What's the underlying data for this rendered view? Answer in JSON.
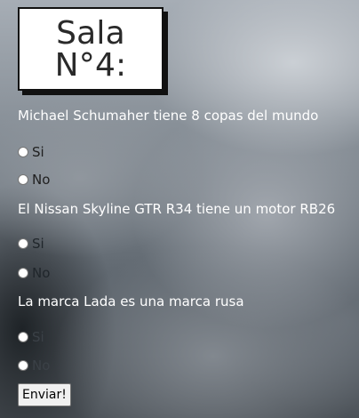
{
  "title": "Sala\nN°4:",
  "questions": [
    {
      "text": "Michael Schumaher tiene 8 copas del mundo",
      "options": [
        "Si",
        "No"
      ]
    },
    {
      "text": "El Nissan Skyline GTR R34 tiene un motor RB26",
      "options": [
        "Si",
        "No"
      ]
    },
    {
      "text": "La marca Lada es una marca rusa",
      "options": [
        "Si",
        "No"
      ]
    }
  ],
  "submit_label": "Enviar!"
}
